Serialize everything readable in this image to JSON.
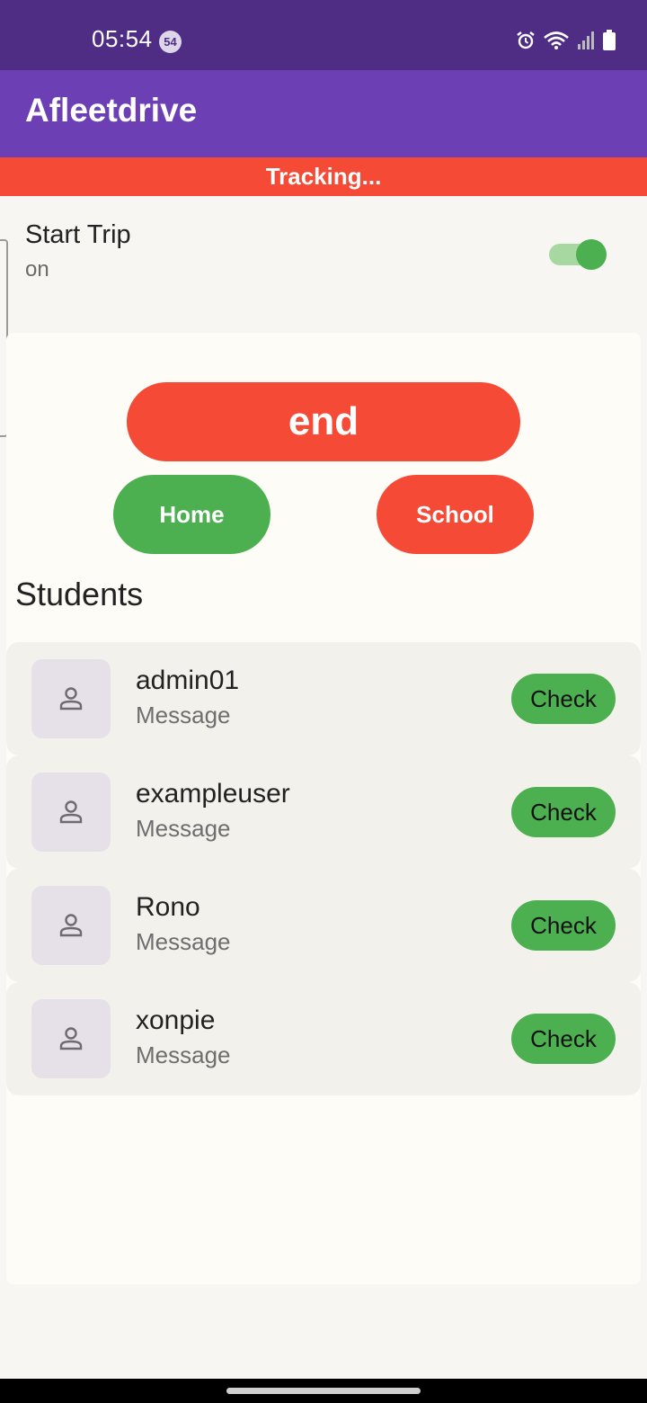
{
  "status_bar": {
    "time": "05:54",
    "notification_count": "54",
    "icons": [
      "alarm-icon",
      "wifi-icon",
      "signal-icon",
      "battery-icon"
    ]
  },
  "app_bar": {
    "title": "Afleetdrive"
  },
  "tracking_banner": {
    "text": "Tracking..."
  },
  "trip": {
    "title": "Start Trip",
    "status": "on",
    "toggle_on": true
  },
  "actions": {
    "end_label": "end",
    "home_label": "Home",
    "school_label": "School"
  },
  "students_section": {
    "title": "Students"
  },
  "students": [
    {
      "name": "admin01",
      "message": "Message",
      "action": "Check"
    },
    {
      "name": "exampleuser",
      "message": "Message",
      "action": "Check"
    },
    {
      "name": "Rono",
      "message": "Message",
      "action": "Check"
    },
    {
      "name": "xonpie",
      "message": "Message",
      "action": "Check"
    }
  ],
  "colors": {
    "status_bar": "#4f2d85",
    "app_bar": "#6c3fb4",
    "danger": "#f44a36",
    "success": "#4caf50",
    "background": "#f7f6f2"
  }
}
